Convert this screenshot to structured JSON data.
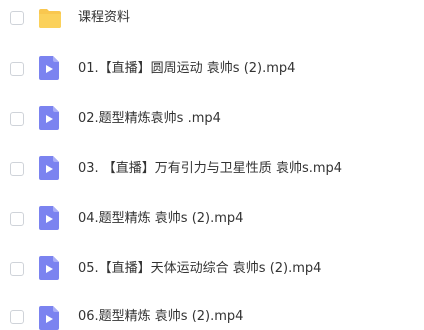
{
  "colors": {
    "folder": "#f9c74f",
    "video_icon": "#7b83f0",
    "text": "#333333",
    "checkbox_border": "#cfd3d9"
  },
  "items": [
    {
      "name": "课程资料",
      "icon": "folder-icon"
    },
    {
      "name": "01.【直播】圆周运动 袁帅s (2).mp4",
      "icon": "video-file-icon"
    },
    {
      "name": "02.题型精炼袁帅s .mp4",
      "icon": "video-file-icon"
    },
    {
      "name": "03. 【直播】万有引力与卫星性质 袁帅s.mp4",
      "icon": "video-file-icon"
    },
    {
      "name": "04.题型精炼 袁帅s (2).mp4",
      "icon": "video-file-icon"
    },
    {
      "name": "05.【直播】天体运动综合 袁帅s (2).mp4",
      "icon": "video-file-icon"
    },
    {
      "name": "06.题型精炼 袁帅s (2).mp4",
      "icon": "video-file-icon"
    }
  ]
}
